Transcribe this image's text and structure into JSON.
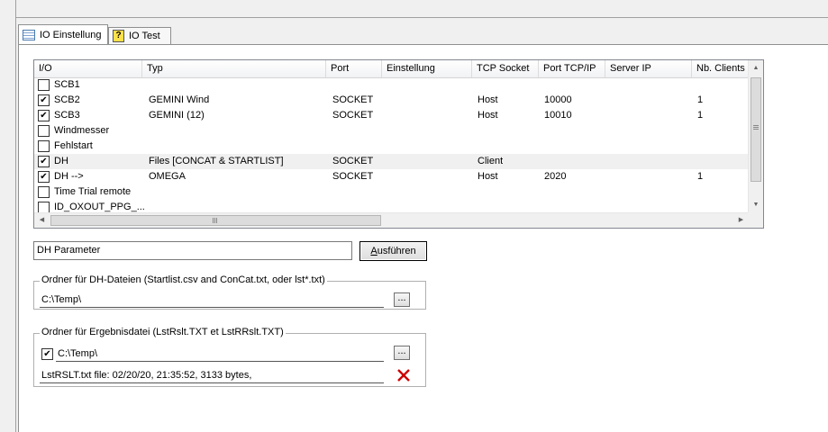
{
  "tabs": [
    {
      "label": "IO Einstellung",
      "icon": "grid-icon",
      "active": true
    },
    {
      "label": "IO Test",
      "icon": "help-icon",
      "active": false
    }
  ],
  "io_list": {
    "columns": [
      "I/O",
      "Typ",
      "Port",
      "Einstellung",
      "TCP Socket",
      "Port TCP/IP",
      "Server IP",
      "Nb. Clients"
    ],
    "rows": [
      {
        "checked": false,
        "io": "SCB1",
        "typ": "",
        "port": "",
        "einstellung": "",
        "tcp": "",
        "port_tcp": "",
        "server_ip": "",
        "clients": ""
      },
      {
        "checked": true,
        "io": "SCB2",
        "typ": "GEMINI Wind",
        "port": "SOCKET",
        "einstellung": "",
        "tcp": "Host",
        "port_tcp": "10000",
        "server_ip": "",
        "clients": "1"
      },
      {
        "checked": true,
        "io": "SCB3",
        "typ": "GEMINI (12)",
        "port": "SOCKET",
        "einstellung": "",
        "tcp": "Host",
        "port_tcp": "10010",
        "server_ip": "",
        "clients": "1"
      },
      {
        "checked": false,
        "io": "Windmesser",
        "typ": "",
        "port": "",
        "einstellung": "",
        "tcp": "",
        "port_tcp": "",
        "server_ip": "",
        "clients": ""
      },
      {
        "checked": false,
        "io": "Fehlstart",
        "typ": "",
        "port": "",
        "einstellung": "",
        "tcp": "",
        "port_tcp": "",
        "server_ip": "",
        "clients": ""
      },
      {
        "checked": true,
        "io": "DH",
        "typ": "Files [CONCAT & STARTLIST]",
        "port": "SOCKET",
        "einstellung": "",
        "tcp": "Client",
        "port_tcp": "",
        "server_ip": "",
        "clients": ""
      },
      {
        "checked": true,
        "io": "DH  -->",
        "typ": "OMEGA",
        "port": "SOCKET",
        "einstellung": "",
        "tcp": "Host",
        "port_tcp": "2020",
        "server_ip": "",
        "clients": "1"
      },
      {
        "checked": false,
        "io": "Time Trial remote",
        "typ": "",
        "port": "",
        "einstellung": "",
        "tcp": "",
        "port_tcp": "",
        "server_ip": "",
        "clients": ""
      },
      {
        "checked": false,
        "io": "ID_OXOUT_PPG_...",
        "typ": "",
        "port": "",
        "einstellung": "",
        "tcp": "",
        "port_tcp": "",
        "server_ip": "",
        "clients": ""
      }
    ],
    "selected_row": 5
  },
  "dh_params": {
    "value": "DH Parameter",
    "run_label": "Ausführen",
    "run_accel": "A",
    "run_rest": "usführen"
  },
  "dh_folder": {
    "legend": "Ordner für DH-Dateien (Startlist.csv and ConCat.txt, oder lst*.txt)",
    "path": "C:\\Temp\\",
    "browse_label": "..."
  },
  "result_folder": {
    "legend": "Ordner für Ergebnisdatei (LstRslt.TXT et LstRRslt.TXT)",
    "checked": true,
    "path": "C:\\Temp\\",
    "browse_label": "...",
    "status": "LstRSLT.txt file: 02/20/20, 21:35:52, 3133 bytes,"
  },
  "colors": {
    "delete_icon": "#cc0000",
    "selected_row": "#f0f0f0"
  }
}
